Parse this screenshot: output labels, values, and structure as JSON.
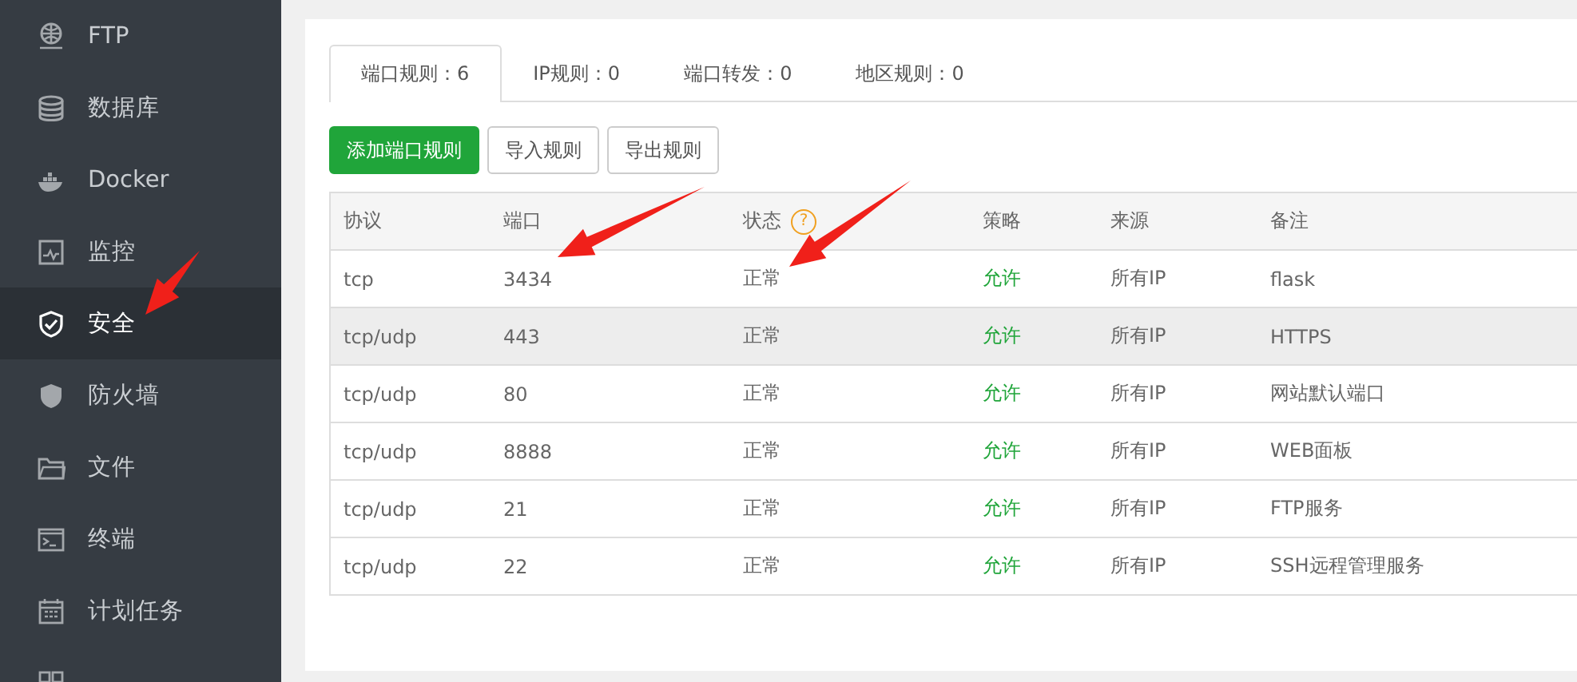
{
  "sidebar": {
    "items": [
      {
        "label": "FTP",
        "selected": false
      },
      {
        "label": "数据库",
        "selected": false
      },
      {
        "label": "Docker",
        "selected": false
      },
      {
        "label": "监控",
        "selected": false
      },
      {
        "label": "安全",
        "selected": true
      },
      {
        "label": "防火墙",
        "selected": false
      },
      {
        "label": "文件",
        "selected": false
      },
      {
        "label": "终端",
        "selected": false
      },
      {
        "label": "计划任务",
        "selected": false
      },
      {
        "selected": false
      }
    ]
  },
  "tabs": [
    {
      "label": "端口规则：6",
      "selected": true
    },
    {
      "label": "IP规则：0",
      "selected": false
    },
    {
      "label": "端口转发：0",
      "selected": false
    },
    {
      "label": "地区规则：0",
      "selected": false
    }
  ],
  "buttons": [
    {
      "label": "添加端口规则",
      "kind": "primary"
    },
    {
      "label": "导入规则",
      "kind": "default"
    },
    {
      "label": "导出规则",
      "kind": "default"
    }
  ],
  "table": {
    "columns": [
      {
        "label": "协议"
      },
      {
        "label": "端口"
      },
      {
        "label": "状态",
        "help": "?"
      },
      {
        "label": "策略"
      },
      {
        "label": "来源"
      },
      {
        "label": "备注"
      }
    ],
    "rows": [
      {
        "cells": [
          "tcp",
          "3434",
          "正常",
          "允许",
          "所有IP",
          "flask"
        ],
        "highlighted": false
      },
      {
        "cells": [
          "tcp/udp",
          "443",
          "正常",
          "允许",
          "所有IP",
          "HTTPS"
        ],
        "highlighted": true
      },
      {
        "cells": [
          "tcp/udp",
          "80",
          "正常",
          "允许",
          "所有IP",
          "网站默认端口"
        ],
        "highlighted": false
      },
      {
        "cells": [
          "tcp/udp",
          "8888",
          "正常",
          "允许",
          "所有IP",
          "WEB面板"
        ],
        "highlighted": false
      },
      {
        "cells": [
          "tcp/udp",
          "21",
          "正常",
          "允许",
          "所有IP",
          "FTP服务"
        ],
        "highlighted": false
      },
      {
        "cells": [
          "tcp/udp",
          "22",
          "正常",
          "允许",
          "所有IP",
          "SSH远程管理服务"
        ],
        "highlighted": false
      }
    ]
  }
}
